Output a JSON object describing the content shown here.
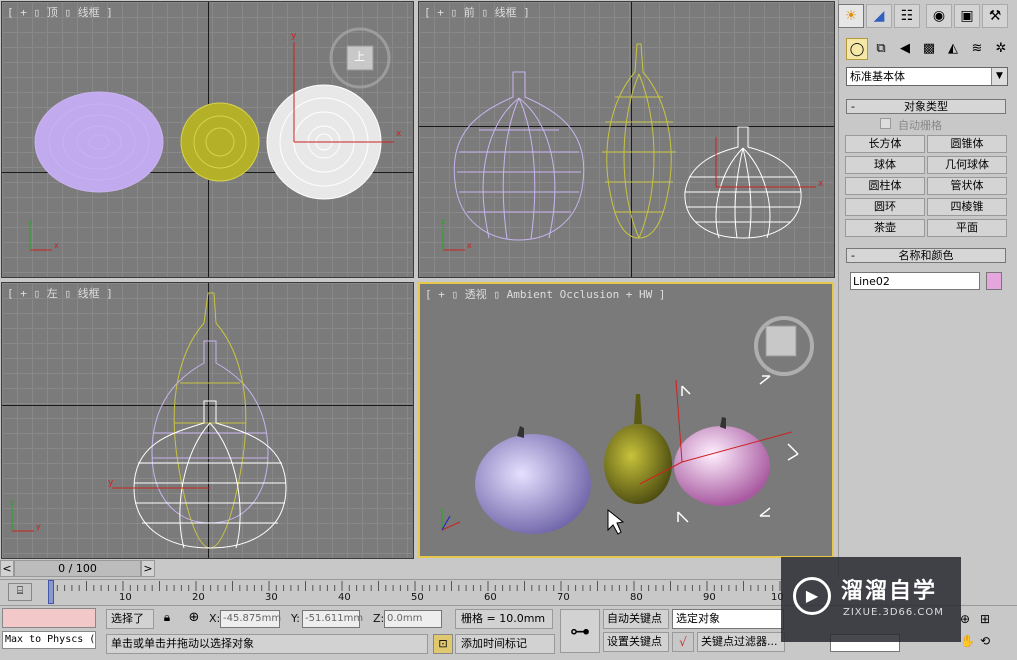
{
  "viewports": {
    "top": {
      "label": "[ + ▯ 顶 ▯ 线框 ]"
    },
    "front": {
      "label": "[ + ▯ 前 ▯ 线框 ]"
    },
    "left": {
      "label": "[ + ▯ 左 ▯ 线框 ]"
    },
    "persp": {
      "label": "[ + ▯ 透视 ▯ Ambient Occlusion + HW ]"
    },
    "viewcube_top_text": "上"
  },
  "command_panel": {
    "tabs": [
      "create",
      "modify",
      "hierarchy",
      "motion",
      "display",
      "utilities"
    ],
    "subtabs": [
      "geometry",
      "shapes",
      "lights",
      "cameras",
      "helpers",
      "spacewarps",
      "systems"
    ],
    "category_dropdown": "标准基本体",
    "object_type_title": "对象类型",
    "auto_grid_label": "自动栅格",
    "object_buttons": [
      "长方体",
      "圆锥体",
      "球体",
      "几何球体",
      "圆柱体",
      "管状体",
      "圆环",
      "四棱锥",
      "茶壶",
      "平面"
    ],
    "name_color_title": "名称和颜色",
    "object_name": "Line02",
    "object_color": "#e4a6dc",
    "rollout_minus": "-"
  },
  "timeline": {
    "frame_label": "0 / 100",
    "ticks": [
      "0",
      "10",
      "20",
      "30",
      "40",
      "50",
      "60",
      "70",
      "80",
      "90",
      "10"
    ],
    "prev": "<",
    "next": ">"
  },
  "status": {
    "script_text": "Max to Physcs (",
    "selection_label": "选择了",
    "x_label": "X:",
    "x_value": "-45.875mm",
    "y_label": "Y:",
    "y_value": "-51.611mm",
    "z_label": "Z:",
    "z_value": "0.0mm",
    "grid_label": "栅格 = 10.0mm",
    "prompt": "单击或单击并拖动以选择对象",
    "add_time_tag": "添加时间标记",
    "auto_key": "自动关键点",
    "set_key": "设置关键点",
    "selected_object": "选定对象",
    "key_filters": "关键点过滤器..."
  },
  "watermark": {
    "title": "溜溜自学",
    "url": "ZIXUE.3D66.COM"
  },
  "colors": {
    "viewport_bg": "#7b7b7b",
    "active_border": "#e8c84a",
    "purple": "#c8b4f0",
    "olive": "#b8b428",
    "white": "#ffffff",
    "pink": "#e4a6dc"
  }
}
